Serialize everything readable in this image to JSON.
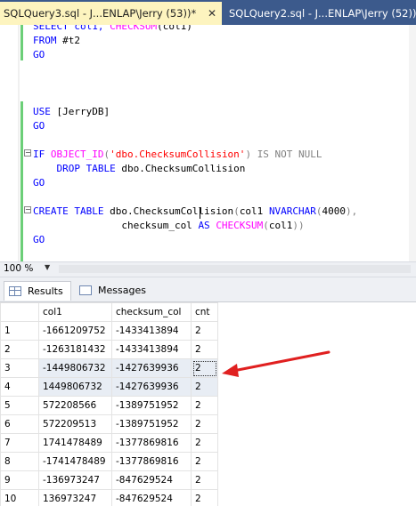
{
  "tabs": {
    "active_label": "SQLQuery3.sql - J...ENLAP\\Jerry (53))*",
    "active_close": "✕",
    "inactive_label": "SQLQuery2.sql - J...ENLAP\\Jerry (52))"
  },
  "editor": {
    "lines": [
      {
        "segments": [
          {
            "text": "SELECT col1, ",
            "cls": "kw"
          },
          {
            "text": "CHECKSUM",
            "cls": "fn"
          },
          {
            "text": "(col1)",
            "cls": ""
          }
        ]
      },
      {
        "segments": [
          {
            "text": "FROM",
            "cls": "kw"
          },
          {
            "text": " #t2",
            "cls": ""
          }
        ]
      },
      {
        "segments": [
          {
            "text": "GO",
            "cls": "kw"
          }
        ]
      },
      {
        "segments": [
          {
            "text": "USE",
            "cls": "kw"
          },
          {
            "text": " [JerryDB]",
            "cls": ""
          }
        ]
      },
      {
        "segments": [
          {
            "text": "GO",
            "cls": "kw"
          }
        ]
      },
      {
        "segments": [
          {
            "text": "IF",
            "cls": "kw"
          },
          {
            "text": " ",
            "cls": ""
          },
          {
            "text": "OBJECT_ID",
            "cls": "fn"
          },
          {
            "text": "(",
            "cls": "gray"
          },
          {
            "text": "'dbo.ChecksumCollision'",
            "cls": "str"
          },
          {
            "text": ") ",
            "cls": "gray"
          },
          {
            "text": "IS NOT NULL",
            "cls": "gray"
          }
        ]
      },
      {
        "segments": [
          {
            "text": "    DROP TABLE",
            "cls": "kw"
          },
          {
            "text": " dbo.ChecksumCollision",
            "cls": ""
          }
        ]
      },
      {
        "segments": [
          {
            "text": "GO",
            "cls": "kw"
          }
        ]
      },
      {
        "segments": [
          {
            "text": "CREATE TABLE",
            "cls": "kw"
          },
          {
            "text": " dbo.ChecksumCollision",
            "cls": ""
          },
          {
            "text": "(",
            "cls": "gray"
          },
          {
            "text": "col1 ",
            "cls": ""
          },
          {
            "text": "NVARCHAR",
            "cls": "kw"
          },
          {
            "text": "(",
            "cls": "gray"
          },
          {
            "text": "4000",
            "cls": ""
          },
          {
            "text": "),",
            "cls": "gray"
          }
        ]
      },
      {
        "segments": [
          {
            "text": "               checksum_col ",
            "cls": ""
          },
          {
            "text": "AS",
            "cls": "kw"
          },
          {
            "text": " ",
            "cls": ""
          },
          {
            "text": "CHECKSUM",
            "cls": "fn"
          },
          {
            "text": "(",
            "cls": "gray"
          },
          {
            "text": "col1",
            "cls": ""
          },
          {
            "text": "))",
            "cls": "gray"
          }
        ]
      },
      {
        "segments": [
          {
            "text": "GO",
            "cls": "kw"
          }
        ]
      }
    ]
  },
  "zoom": {
    "value": "100 %"
  },
  "results_tabs": {
    "results_label": "Results",
    "messages_label": "Messages"
  },
  "grid": {
    "columns": [
      "col1",
      "checksum_col",
      "cnt"
    ],
    "rows": [
      {
        "n": "1",
        "col1": "-1661209752",
        "checksum_col": "-1433413894",
        "cnt": "2"
      },
      {
        "n": "2",
        "col1": "-1263181432",
        "checksum_col": "-1433413894",
        "cnt": "2"
      },
      {
        "n": "3",
        "col1": "-1449806732",
        "checksum_col": "-1427639936",
        "cnt": "2"
      },
      {
        "n": "4",
        "col1": "1449806732",
        "checksum_col": "-1427639936",
        "cnt": "2"
      },
      {
        "n": "5",
        "col1": "572208566",
        "checksum_col": "-1389751952",
        "cnt": "2"
      },
      {
        "n": "6",
        "col1": "572209513",
        "checksum_col": "-1389751952",
        "cnt": "2"
      },
      {
        "n": "7",
        "col1": "1741478489",
        "checksum_col": "-1377869816",
        "cnt": "2"
      },
      {
        "n": "8",
        "col1": "-1741478489",
        "checksum_col": "-1377869816",
        "cnt": "2"
      },
      {
        "n": "9",
        "col1": "-136973247",
        "checksum_col": "-847629524",
        "cnt": "2"
      },
      {
        "n": "10",
        "col1": "136973247",
        "checksum_col": "-847629524",
        "cnt": "2"
      }
    ]
  },
  "colors": {
    "annotation_arrow": "#e02020",
    "tab_bar": "#3c5a8c",
    "active_tab": "#fdf4bf"
  }
}
